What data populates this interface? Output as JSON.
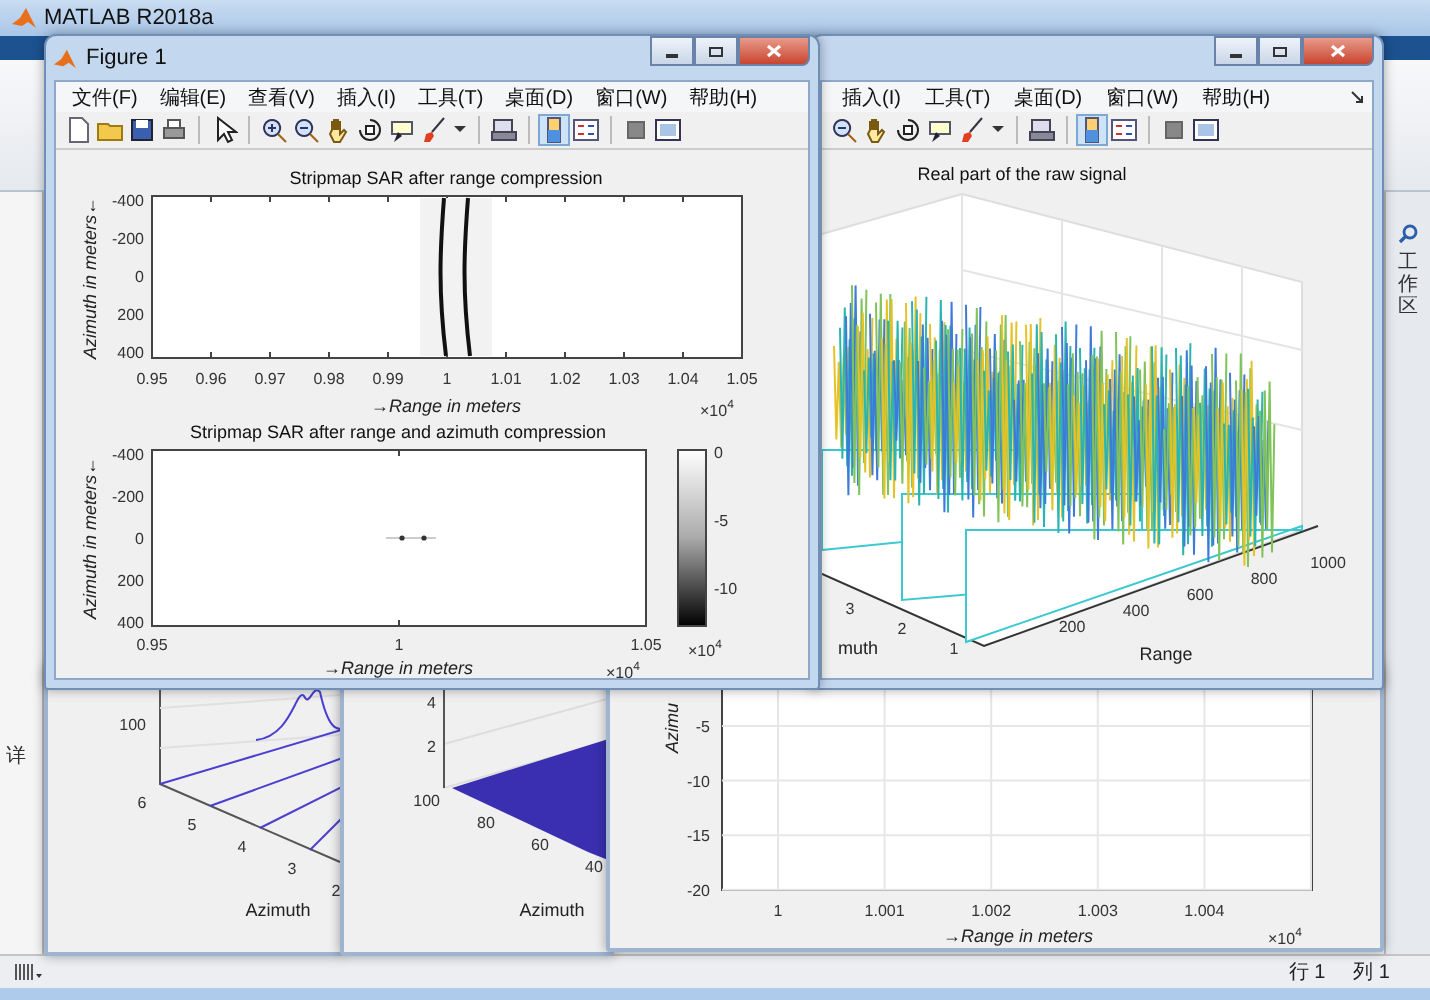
{
  "app": {
    "title": "MATLAB R2018a",
    "left_panel_label": "详",
    "workspace_label": "工作区",
    "status_bar": {
      "row": "行 1",
      "column": "列 1"
    }
  },
  "figure_1": {
    "title": "Figure 1",
    "menu": [
      "文件(F)",
      "编辑(E)",
      "查看(V)",
      "插入(I)",
      "工具(T)",
      "桌面(D)",
      "窗口(W)",
      "帮助(H)"
    ],
    "plots": [
      {
        "title": "Stripmap SAR after range compression",
        "xlabel": "→Range in meters",
        "ylabel": "Azimuth in meters←",
        "xticks": [
          "0.95",
          "0.96",
          "0.97",
          "0.98",
          "0.99",
          "1",
          "1.01",
          "1.02",
          "1.03",
          "1.04",
          "1.05"
        ],
        "yticks": [
          "-400",
          "-200",
          "0",
          "200",
          "400"
        ],
        "x_exponent": {
          "base": "×10",
          "power": "4"
        }
      },
      {
        "title": "Stripmap SAR after range and azimuth compression",
        "xlabel": "→Range in meters",
        "ylabel": "Azimuth in meters←",
        "xticks": [
          "0.95",
          "1",
          "1.05"
        ],
        "yticks": [
          "-400",
          "-200",
          "0",
          "200",
          "400"
        ],
        "x_exponent": {
          "base": "×10",
          "power": "4"
        },
        "colorbar": {
          "ticks": [
            "0",
            "-5",
            "-10"
          ],
          "exponent": {
            "base": "×10",
            "power": "4"
          }
        }
      }
    ]
  },
  "figure_2": {
    "menu": [
      "插入(I)",
      "工具(T)",
      "桌面(D)",
      "窗口(W)",
      "帮助(H)"
    ],
    "plot": {
      "title": "Real part of the raw signal",
      "xlabel": "Range",
      "ylabel": "muth",
      "xticks": [
        "200",
        "400",
        "600",
        "800",
        "1000"
      ],
      "yticks": [
        "1",
        "2",
        "3"
      ]
    }
  },
  "figure_3": {
    "zticks": [
      "100"
    ],
    "yticks": [
      "6",
      "5",
      "4",
      "3",
      "2"
    ],
    "ylabel": "Azimuth"
  },
  "figure_4": {
    "zticks": [
      "4",
      "2"
    ],
    "yticks": [
      "100",
      "80",
      "60",
      "40"
    ],
    "ylabel": "Azimuth"
  },
  "figure_5": {
    "ylabel": "Azimu",
    "yticks": [
      "-5",
      "-10",
      "-15",
      "-20"
    ],
    "xticks": [
      "1",
      "1.001",
      "1.002",
      "1.003",
      "1.004"
    ],
    "xlabel": "→Range in meters",
    "x_exponent": {
      "base": "×10",
      "power": "4"
    }
  }
}
